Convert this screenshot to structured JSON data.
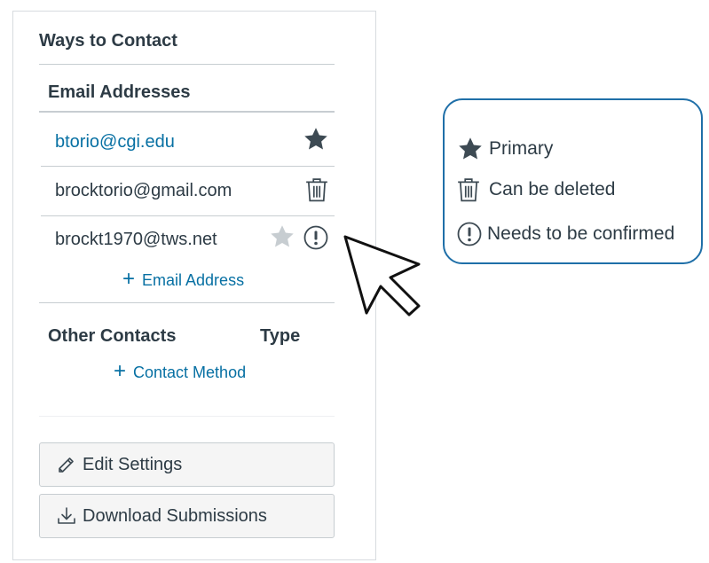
{
  "panel": {
    "title": "Ways to Contact",
    "email_section": {
      "heading": "Email Addresses",
      "emails": [
        {
          "address": "btorio@cgi.edu",
          "icon": "star-icon",
          "status": "primary"
        },
        {
          "address": "brocktorio@gmail.com",
          "icon": "trash-icon",
          "status": "deletable"
        },
        {
          "address": "brockt1970@tws.net",
          "icons": [
            "star-outline-icon",
            "exclamation-circle-icon"
          ],
          "status": "unconfirmed"
        }
      ],
      "add_label": "Email Address"
    },
    "other_section": {
      "heading": "Other Contacts",
      "type_heading": "Type",
      "add_label": "Contact Method"
    },
    "buttons": {
      "edit_settings": "Edit Settings",
      "download_submissions": "Download Submissions"
    }
  },
  "legend": {
    "items": [
      {
        "icon": "star-icon",
        "label": "Primary"
      },
      {
        "icon": "trash-icon",
        "label": "Can be deleted"
      },
      {
        "icon": "exclamation-circle-icon",
        "label": "Needs to be confirmed"
      }
    ]
  },
  "colors": {
    "link": "#0770a3",
    "text": "#2d3b45",
    "legend_border": "#1f6fa8",
    "star_dark": "#3d4a53",
    "star_light": "#c7cdd1"
  }
}
